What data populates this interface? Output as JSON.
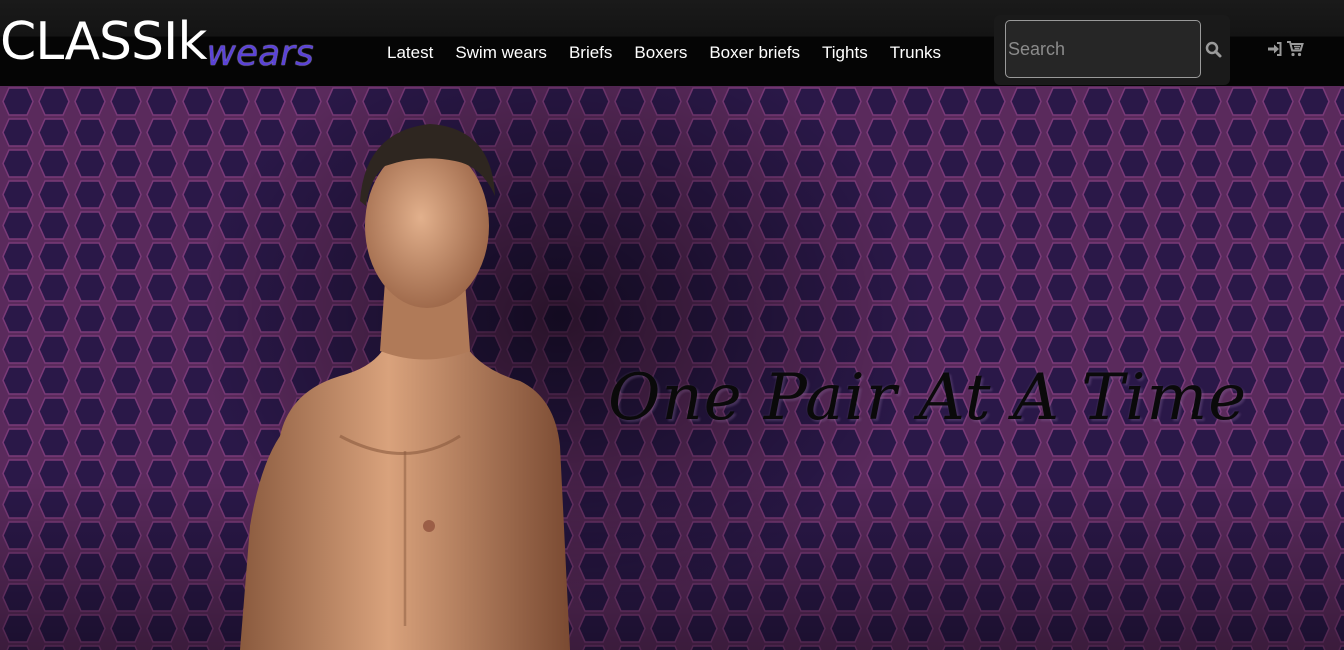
{
  "brand": {
    "main": "CLASSIk",
    "accent": "wears",
    "accent_color": "#5b43d6"
  },
  "nav": {
    "links": [
      "Latest",
      "Swim wears",
      "Briefs",
      "Boxers",
      "Boxer briefs",
      "Tights",
      "Trunks"
    ]
  },
  "search": {
    "placeholder": "Search",
    "value": "",
    "button_icon": "search-icon"
  },
  "account_icons": [
    "sign-in-icon",
    "shopping-cart-icon"
  ],
  "hero": {
    "tagline": "One Pair At A Time",
    "background_color": "#3b1f45",
    "pattern": "hexagon-knit"
  }
}
